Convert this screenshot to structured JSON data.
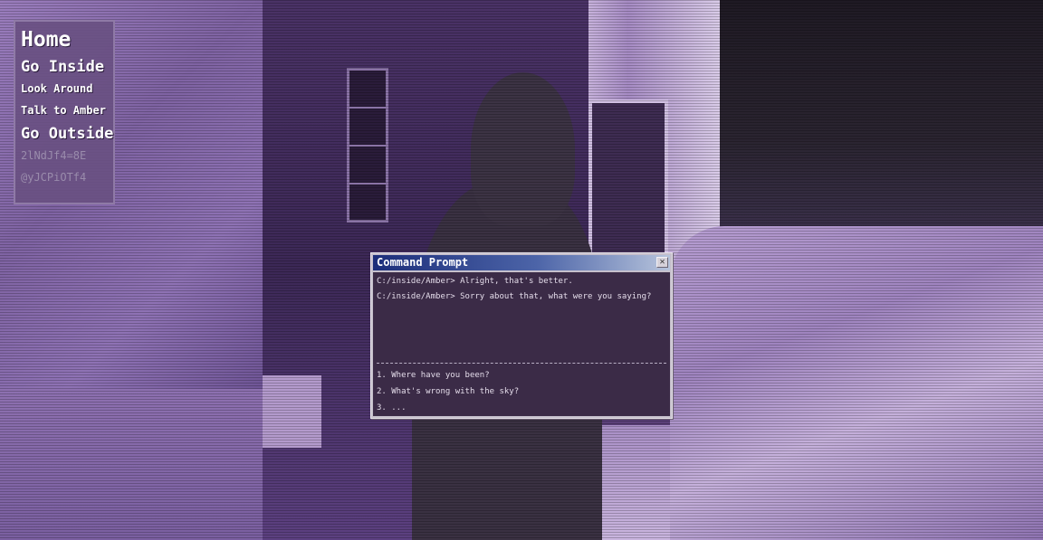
{
  "nav": {
    "home": "Home",
    "go_inside": "Go Inside",
    "look_around": "Look Around",
    "talk_to_amber": "Talk to Amber",
    "go_outside": "Go Outside",
    "code1": "2lNdJf4=8E",
    "code2": "@yJCPiOTf4"
  },
  "cmd": {
    "title": "Command Prompt",
    "close_glyph": "✕",
    "lines": [
      "C:/inside/Amber> Alright, that's better.",
      "C:/inside/Amber> Sorry about that, what were you saying?"
    ],
    "options": [
      "1. Where have you been?",
      "2. What's wrong with the sky?",
      "3. ..."
    ]
  },
  "colors": {
    "accent": "#5a3f78",
    "title_bar": "#1c2e7a"
  }
}
